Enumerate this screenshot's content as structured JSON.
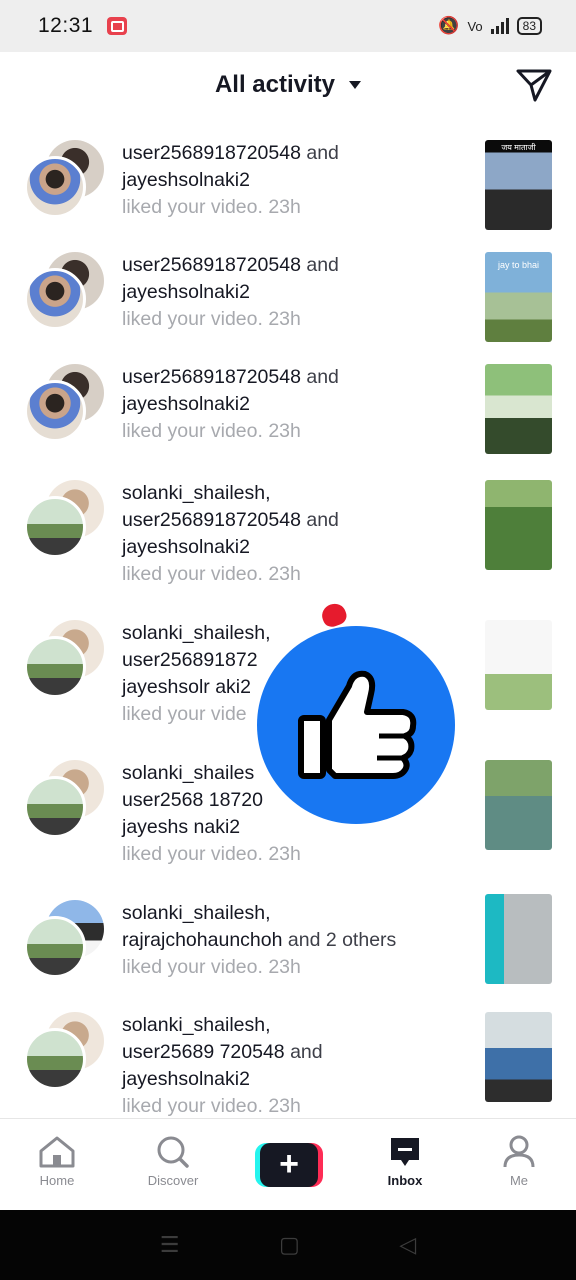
{
  "status_bar": {
    "time": "12:31",
    "battery": "83"
  },
  "header": {
    "title": "All activity"
  },
  "activity": [
    {
      "avatar_style": "a",
      "line1": "user2568918720548",
      "conj1": "and",
      "line2": "jayeshsolnaki2",
      "conj2": "",
      "line3": "",
      "sub": "liked your video. 23h",
      "thumb": "th1",
      "thumb_caption": "जय माताजी"
    },
    {
      "avatar_style": "a",
      "line1": "user2568918720548",
      "conj1": "and",
      "line2": "jayeshsolnaki2",
      "conj2": "",
      "line3": "",
      "sub": "liked your video. 23h",
      "thumb": "th2",
      "thumb_caption": "jay to bhai"
    },
    {
      "avatar_style": "a",
      "line1": "user2568918720548",
      "conj1": "and",
      "line2": "jayeshsolnaki2",
      "conj2": "",
      "line3": "",
      "sub": "liked your video. 23h",
      "thumb": "th3",
      "thumb_caption": ""
    },
    {
      "avatar_style": "b",
      "line1": "solanki_shailesh,",
      "conj1": "",
      "line2": "user2568918720548",
      "conj2": "and",
      "line3": "jayeshsolnaki2",
      "sub": "liked your video. 23h",
      "thumb": "th4",
      "thumb_caption": ""
    },
    {
      "avatar_style": "b",
      "line1": "solanki_shailesh,",
      "conj1": "",
      "line2": "user256891872",
      "conj2": "",
      "line3": "jayeshsolr aki2",
      "sub": "liked your vide",
      "thumb": "th5",
      "thumb_caption": ""
    },
    {
      "avatar_style": "b",
      "line1": "solanki_shailes",
      "conj1": "",
      "line2": "user2568 18720",
      "conj2": "",
      "line3": "jayeshs naki2",
      "sub": "liked your video. 23h",
      "thumb": "th6",
      "thumb_caption": ""
    },
    {
      "avatar_style": "c",
      "line1": "solanki_shailesh,",
      "conj1": "",
      "line2": "rajrajchohaunchoh",
      "conj2": "and 2 others",
      "line3": "",
      "sub": "liked your video. 23h",
      "thumb": "th7",
      "thumb_caption": ""
    },
    {
      "avatar_style": "b",
      "line1": "solanki_shailesh,",
      "conj1": "",
      "line2": "user25689 720548",
      "conj2": "and",
      "line3": "jayeshsolnaki2",
      "sub": "liked your video. 23h",
      "thumb": "th8",
      "thumb_caption": ""
    }
  ],
  "tabs": [
    {
      "label": "Home",
      "icon": "home-icon"
    },
    {
      "label": "Discover",
      "icon": "search-icon"
    },
    {
      "label": "",
      "icon": "create-icon"
    },
    {
      "label": "Inbox",
      "icon": "inbox-icon"
    },
    {
      "label": "Me",
      "icon": "profile-icon"
    }
  ],
  "colors": {
    "accent_red": "#fe2c55",
    "accent_cyan": "#25f4ee",
    "like_blue": "#1877f2"
  }
}
